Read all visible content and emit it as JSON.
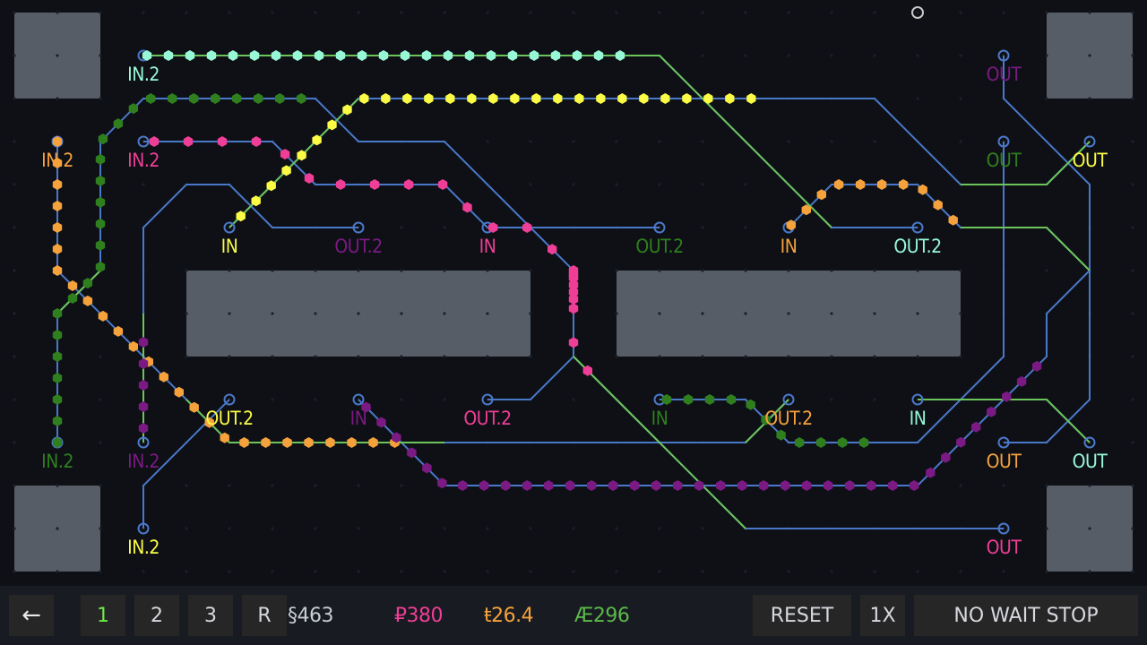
{
  "colors": {
    "background": "#0e1016",
    "track": "#4a78c8",
    "active_track": "#6cc45a",
    "block": "#565d66",
    "bar": "#181b21",
    "button": "#262626",
    "cyan": "#97f7d6",
    "yellow": "#fbfb45",
    "pink": "#ef3e96",
    "orange": "#f5a23c",
    "green": "#2f7f1e",
    "purple": "#7a1a82"
  },
  "ports": [
    {
      "id": "p1",
      "label": "IN.2",
      "color": "cyan"
    },
    {
      "id": "p2",
      "label": "IN.2",
      "color": "orange"
    },
    {
      "id": "p3",
      "label": "IN.2",
      "color": "pink"
    },
    {
      "id": "p4",
      "label": "IN",
      "color": "yellow"
    },
    {
      "id": "p5",
      "label": "OUT.2",
      "color": "purple"
    },
    {
      "id": "p6",
      "label": "IN",
      "color": "pink"
    },
    {
      "id": "p7",
      "label": "OUT.2",
      "color": "green"
    },
    {
      "id": "p8",
      "label": "IN",
      "color": "orange"
    },
    {
      "id": "p9",
      "label": "OUT.2",
      "color": "cyan"
    },
    {
      "id": "p10",
      "label": "OUT",
      "color": "purple"
    },
    {
      "id": "p11",
      "label": "OUT",
      "color": "green"
    },
    {
      "id": "p12",
      "label": "OUT",
      "color": "yellow"
    },
    {
      "id": "p13",
      "label": "OUT.2",
      "color": "yellow"
    },
    {
      "id": "p14",
      "label": "IN",
      "color": "purple"
    },
    {
      "id": "p15",
      "label": "OUT.2",
      "color": "pink"
    },
    {
      "id": "p16",
      "label": "IN",
      "color": "green"
    },
    {
      "id": "p17",
      "label": "OUT.2",
      "color": "orange"
    },
    {
      "id": "p18",
      "label": "IN",
      "color": "cyan"
    },
    {
      "id": "p19",
      "label": "IN.2",
      "color": "green"
    },
    {
      "id": "p20",
      "label": "IN.2",
      "color": "purple"
    },
    {
      "id": "p21",
      "label": "OUT",
      "color": "orange"
    },
    {
      "id": "p22",
      "label": "OUT",
      "color": "cyan"
    },
    {
      "id": "p23",
      "label": "IN.2",
      "color": "yellow"
    },
    {
      "id": "p24",
      "label": "OUT",
      "color": "pink"
    }
  ],
  "toolbar": {
    "back_icon": "←",
    "levels": [
      "1",
      "2",
      "3",
      "R"
    ],
    "active_level": "1",
    "score_parts": "§463",
    "score_pink": "₽380",
    "score_orange": "ŧ26.4",
    "score_green": "Æ296",
    "reset_label": "RESET",
    "speed_label": "1X",
    "mode_label": "NO WAIT STOP"
  },
  "stat_colors": {
    "parts": "#c8ccd4",
    "pink": "#ef3e96",
    "orange": "#f5a23c",
    "green": "#5cb84a",
    "level_active": "#6ee84a"
  }
}
